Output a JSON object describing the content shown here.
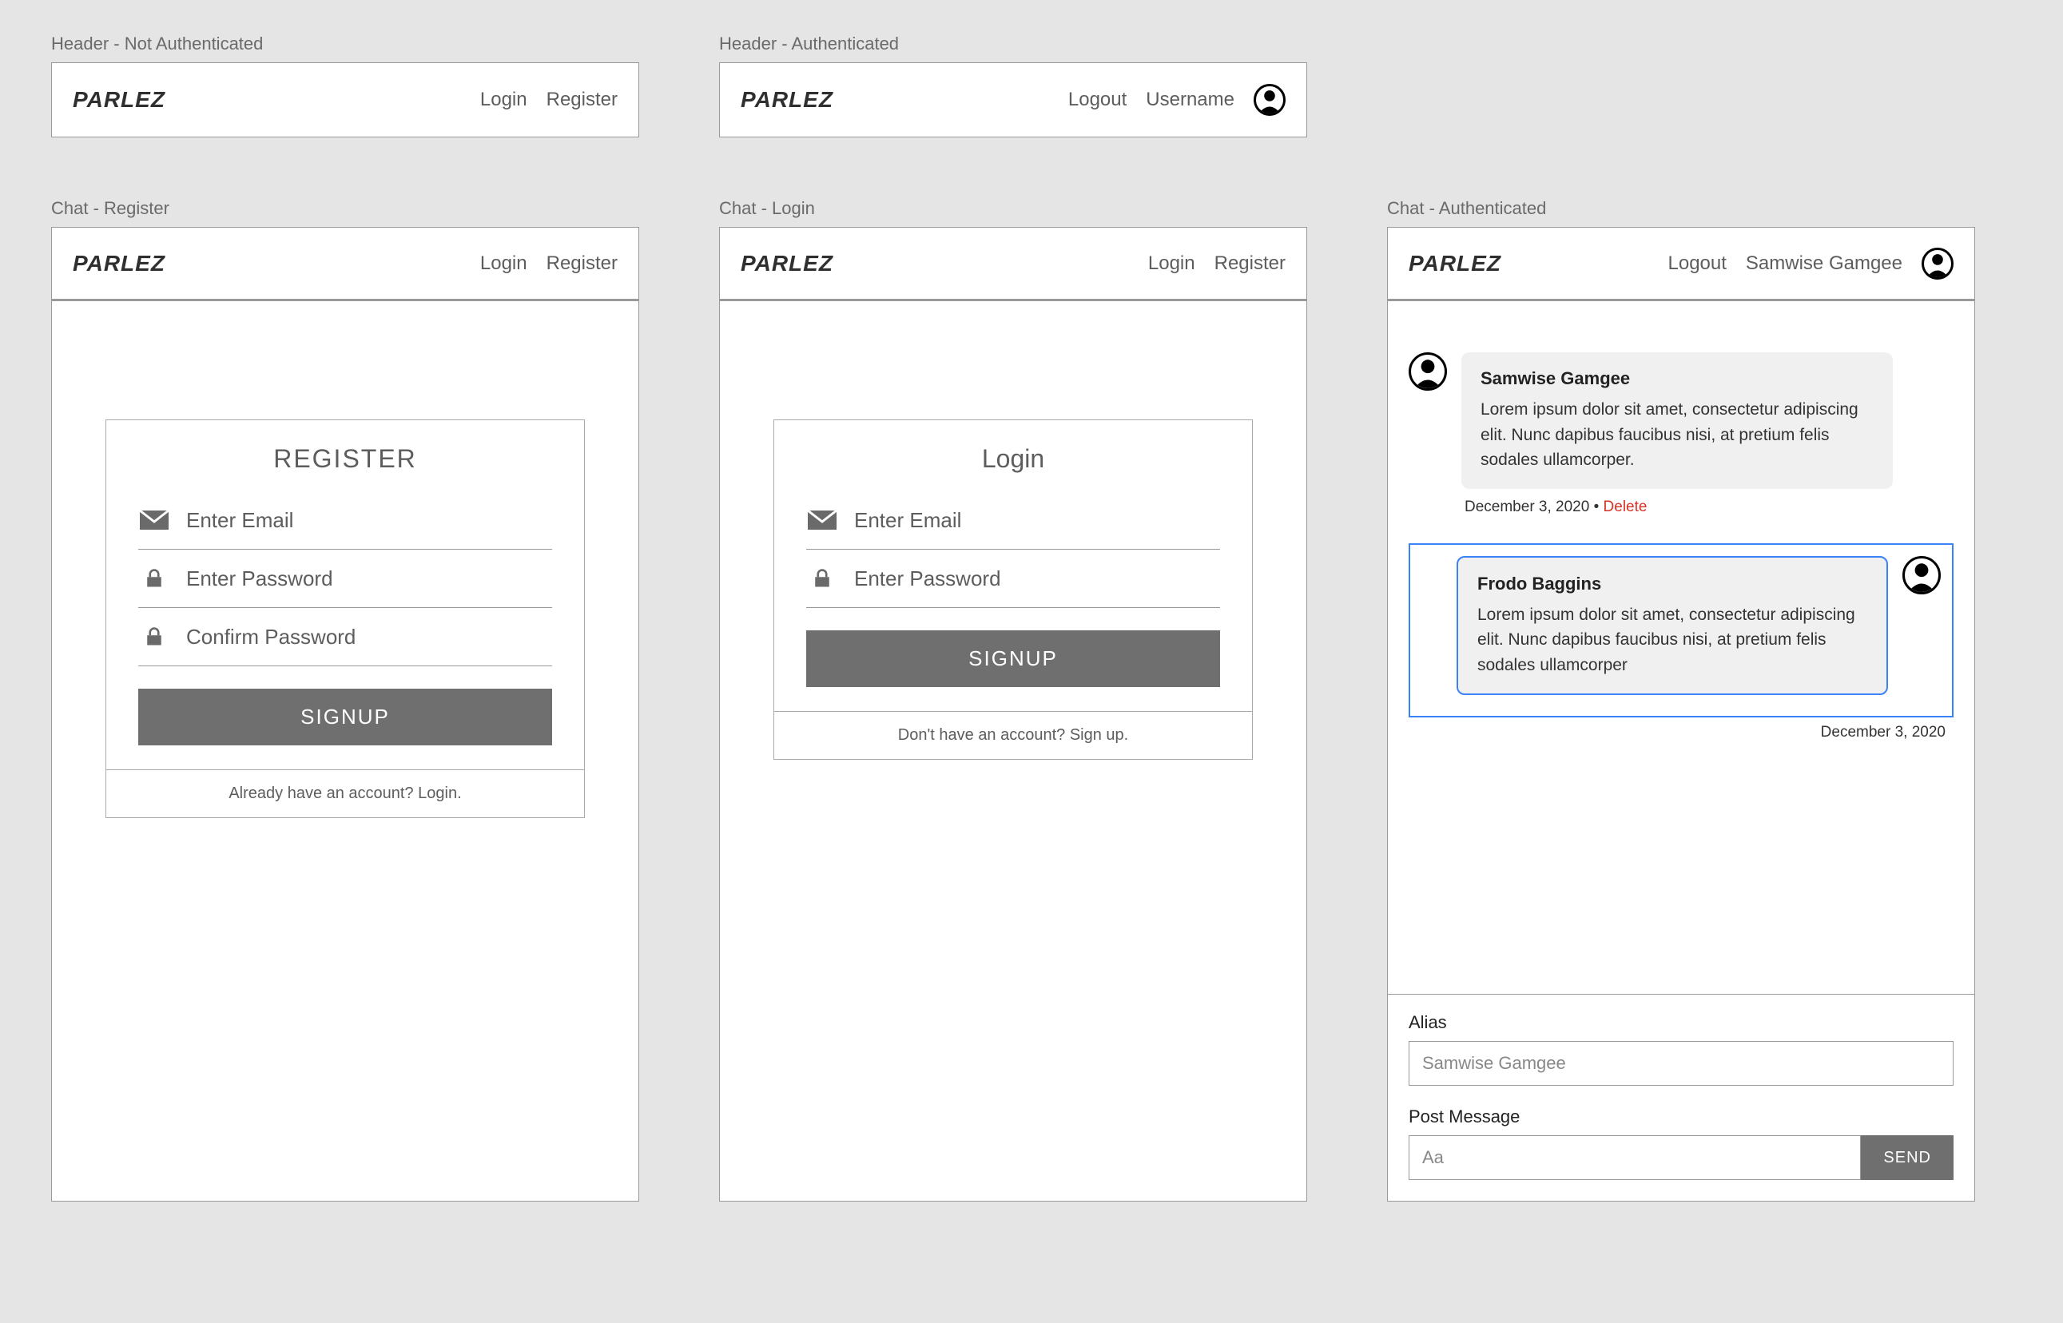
{
  "brand": "PARLEZ",
  "labels": {
    "header_not_auth": "Header - Not Authenticated",
    "header_auth": "Header - Authenticated",
    "chat_register": "Chat - Register",
    "chat_login": "Chat - Login",
    "chat_auth": "Chat - Authenticated"
  },
  "nav": {
    "login": "Login",
    "register": "Register",
    "logout": "Logout",
    "username": "Username",
    "auth_user": "Samwise Gamgee"
  },
  "register_card": {
    "title": "REGISTER",
    "email_ph": "Enter Email",
    "password_ph": "Enter Password",
    "confirm_ph": "Confirm Password",
    "button": "SIGNUP",
    "footer": "Already have an account? Login."
  },
  "login_card": {
    "title": "Login",
    "email_ph": "Enter Email",
    "password_ph": "Enter Password",
    "button": "SIGNUP",
    "footer": "Don't have an account? Sign up."
  },
  "chat": {
    "messages": [
      {
        "author": "Samwise Gamgee",
        "text": "Lorem ipsum dolor sit amet, consectetur adipiscing elit. Nunc dapibus faucibus nisi, at pretium felis sodales ullamcorper.",
        "date": "December 3, 2020",
        "deletable": true
      },
      {
        "author": "Frodo Baggins",
        "text": "Lorem ipsum dolor sit amet, consectetur adipiscing elit. Nunc dapibus faucibus nisi, at pretium felis sodales ullamcorper",
        "date": "December 3, 2020",
        "deletable": false
      }
    ],
    "meta_separator": " • ",
    "delete_label": "Delete",
    "composer": {
      "alias_label": "Alias",
      "alias_value": "Samwise Gamgee",
      "message_label": "Post Message",
      "message_ph": "Aa",
      "send": "SEND"
    }
  }
}
